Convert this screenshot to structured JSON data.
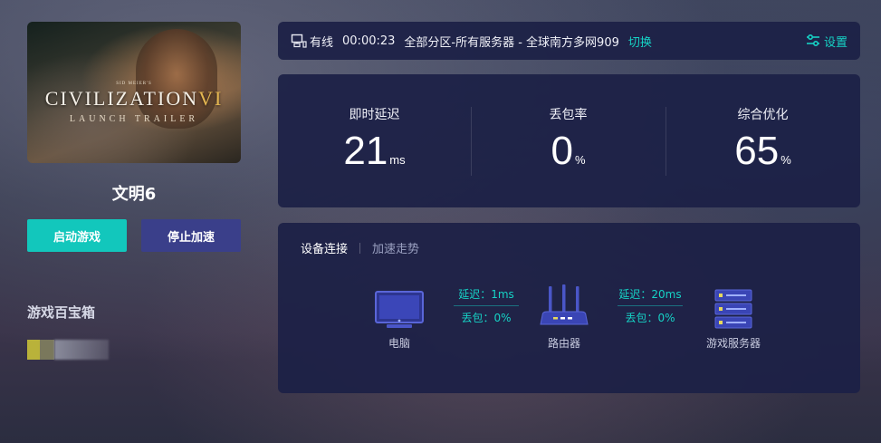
{
  "game": {
    "cover": {
      "subtitle_top": "SID MEIER'S",
      "title_main": "CIVILIZATION",
      "title_numeral": "VI",
      "subtitle": "LAUNCH TRAILER"
    },
    "name": "文明6",
    "start_button": "启动游戏",
    "stop_button": "停止加速"
  },
  "toolbox": {
    "title": "游戏百宝箱"
  },
  "status": {
    "connection_type": "有线",
    "elapsed": "00:00:23",
    "server": "全部分区-所有服务器 - 全球南方多网909",
    "switch_label": "切换",
    "settings_label": "设置"
  },
  "metrics": [
    {
      "label": "即时延迟",
      "value": "21",
      "unit": "ms"
    },
    {
      "label": "丢包率",
      "value": "0",
      "unit": "%"
    },
    {
      "label": "综合优化",
      "value": "65",
      "unit": "%"
    }
  ],
  "connection": {
    "tab_active": "设备连接",
    "tab_inactive": "加速走势",
    "devices": {
      "pc": "电脑",
      "router": "路由器",
      "server": "游戏服务器"
    },
    "links": [
      {
        "latency": "延迟：1ms",
        "loss": "丢包：0%"
      },
      {
        "latency": "延迟：20ms",
        "loss": "丢包：0%"
      }
    ]
  },
  "colors": {
    "accent": "#12c7bc",
    "stop_button": "#3a3f8a",
    "panel": "#1c2046",
    "device_blue": "#4a56c8"
  }
}
